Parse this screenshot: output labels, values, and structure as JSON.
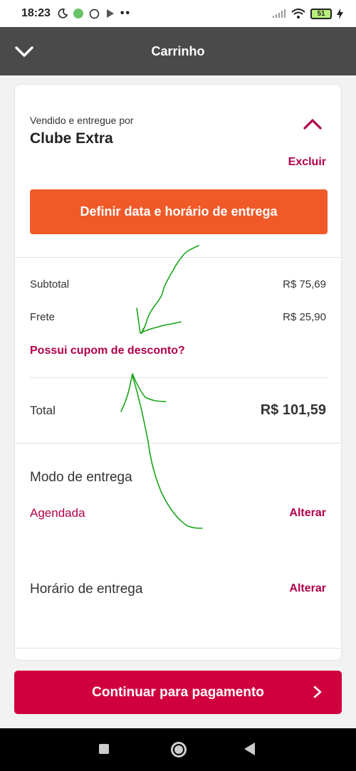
{
  "status_bar": {
    "time": "18:23",
    "battery": "51"
  },
  "header": {
    "title": "Carrinho"
  },
  "seller": {
    "label": "Vendido e entregue por",
    "name": "Clube Extra",
    "remove_label": "Excluir"
  },
  "delivery_button": {
    "label": "Definir data e horário de entrega"
  },
  "summary": {
    "subtotal_label": "Subtotal",
    "subtotal_value": "R$ 75,69",
    "shipping_label": "Frete",
    "shipping_value": "R$ 25,90",
    "coupon_label": "Possui cupom de desconto?",
    "total_label": "Total",
    "total_value": "R$ 101,59"
  },
  "delivery_mode": {
    "title": "Modo de entrega",
    "value": "Agendada",
    "change_label": "Alterar"
  },
  "delivery_time": {
    "title": "Horário de entrega",
    "change_label": "Alterar"
  },
  "continue_button": {
    "label": "Continuar para pagamento"
  },
  "colors": {
    "accent": "#b0004a",
    "primary_button": "#d0003f",
    "delivery_button": "#ef5a28",
    "header_bg": "#4a4a4a",
    "annotation": "#1aa51a"
  },
  "icons": {
    "back": "chevron-down-icon",
    "collapse": "chevron-up-icon",
    "continue": "chevron-right-icon"
  }
}
